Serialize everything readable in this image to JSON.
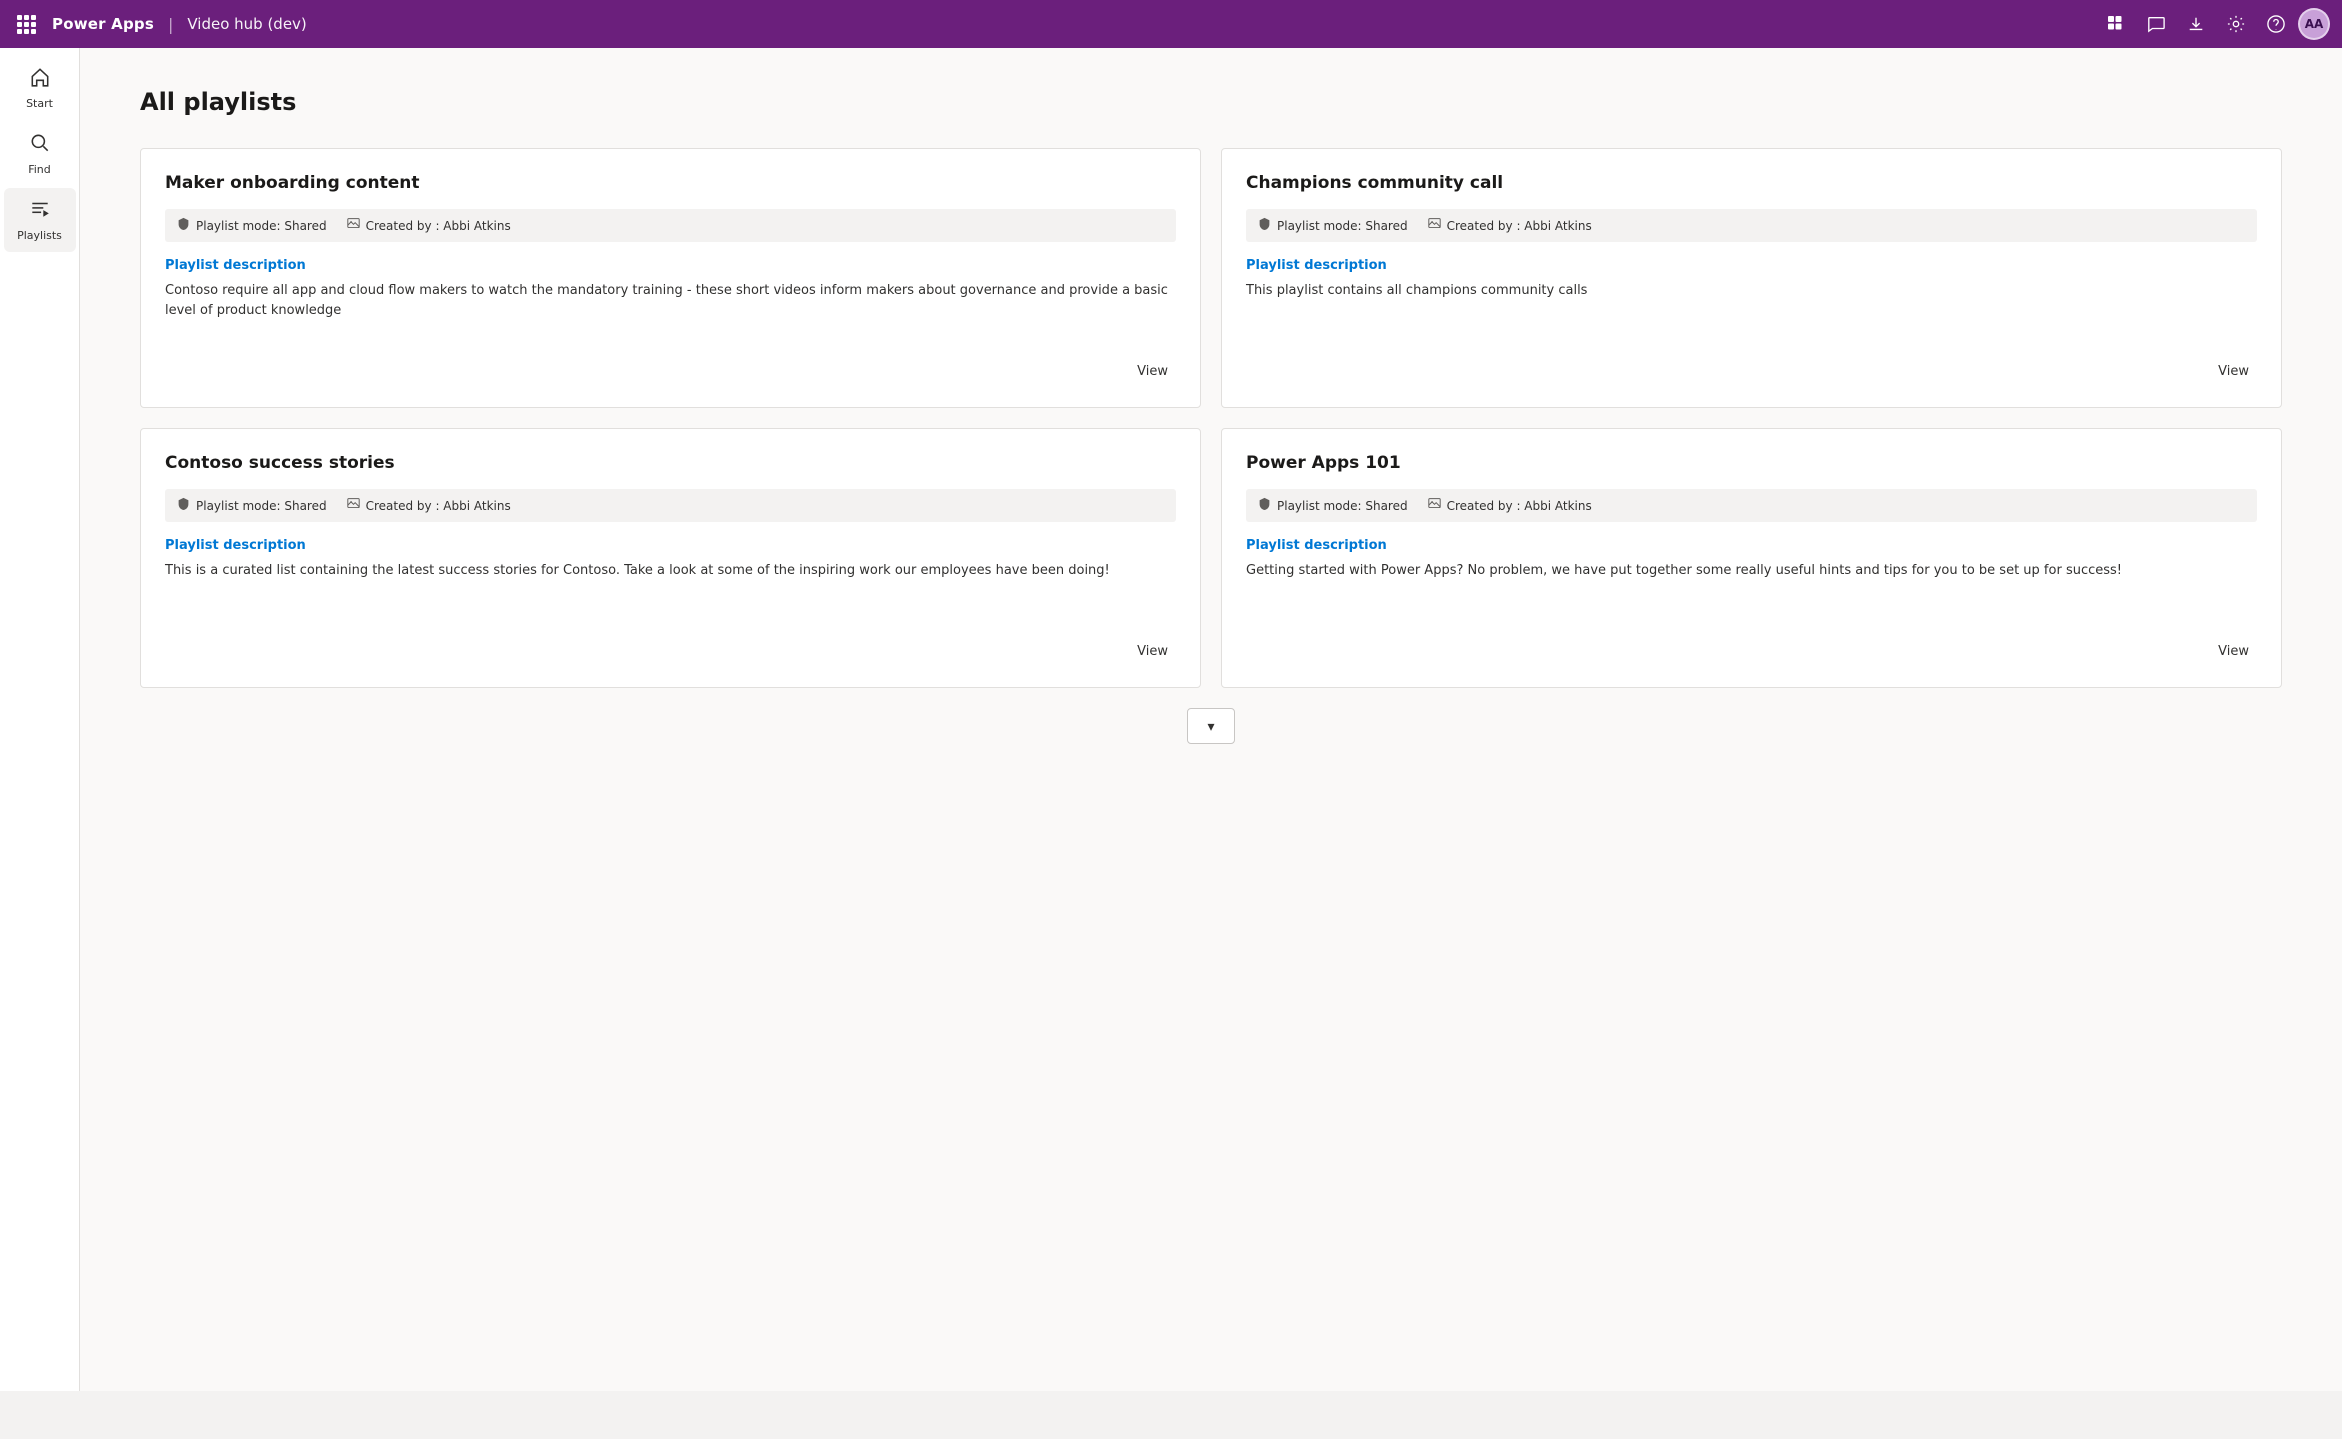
{
  "topbar": {
    "brand": "Power Apps",
    "separator": "|",
    "app_name": "Video hub (dev)",
    "avatar_initials": "AA"
  },
  "sidebar": {
    "items": [
      {
        "id": "start",
        "label": "Start",
        "icon": "🏠"
      },
      {
        "id": "find",
        "label": "Find",
        "icon": "🔍"
      },
      {
        "id": "playlists",
        "label": "Playlists",
        "icon": "☰",
        "active": true
      }
    ]
  },
  "main": {
    "page_title": "All playlists",
    "cards": [
      {
        "id": "maker-onboarding",
        "title": "Maker onboarding content",
        "playlist_mode": "Playlist mode: Shared",
        "created_by": "Created by : Abbi Atkins",
        "description_label": "Playlist description",
        "description": "Contoso require all app and cloud flow makers to watch the mandatory training - these short videos inform makers about governance and provide a basic level of product knowledge",
        "view_label": "View"
      },
      {
        "id": "champions-community",
        "title": "Champions community call",
        "playlist_mode": "Playlist mode: Shared",
        "created_by": "Created by : Abbi Atkins",
        "description_label": "Playlist description",
        "description": "This playlist contains all champions community calls",
        "view_label": "View"
      },
      {
        "id": "contoso-success",
        "title": "Contoso success stories",
        "playlist_mode": "Playlist mode: Shared",
        "created_by": "Created by : Abbi Atkins",
        "description_label": "Playlist description",
        "description": "This is a curated list containing the latest success stories for Contoso.  Take a look at some of the inspiring work our employees have been doing!",
        "view_label": "View"
      },
      {
        "id": "power-apps-101",
        "title": "Power Apps 101",
        "playlist_mode": "Playlist mode: Shared",
        "created_by": "Created by : Abbi Atkins",
        "description_label": "Playlist description",
        "description": "Getting started with Power Apps?  No problem, we have put together some really useful hints and tips for you to be set up for success!",
        "view_label": "View"
      }
    ],
    "scroll_down_label": "▾"
  }
}
